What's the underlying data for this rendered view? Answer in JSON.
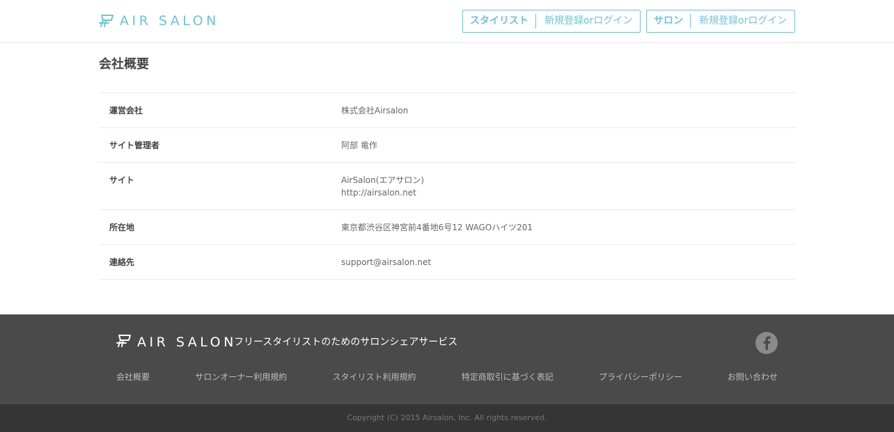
{
  "header": {
    "logo_text": "AIR SALON",
    "stylist": {
      "role": "スタイリスト",
      "action": "新規登録orログイン"
    },
    "salon": {
      "role": "サロン",
      "action": "新規登録orログイン"
    }
  },
  "main": {
    "title": "会社概要",
    "rows": [
      {
        "label": "運営会社",
        "values": [
          "株式会社Airsalon"
        ]
      },
      {
        "label": "サイト管理者",
        "values": [
          "阿部 竜作"
        ]
      },
      {
        "label": "サイト",
        "values": [
          "AirSalon(エアサロン)",
          "http://airsalon.net"
        ]
      },
      {
        "label": "所在地",
        "values": [
          "東京都渋谷区神宮前4番地6号12 WAGOハイツ201"
        ]
      },
      {
        "label": "連絡先",
        "values": [
          "support@airsalon.net"
        ]
      }
    ]
  },
  "footer": {
    "logo_text": "AIR SALON",
    "tagline": "フリースタイリストのためのサロンシェアサービス",
    "social_icon": "facebook-icon",
    "links": [
      "会社概要",
      "サロンオーナー利用規約",
      "スタイリスト利用規約",
      "特定商取引に基づく表記",
      "プライバシーポリシー",
      "お問い合わせ"
    ],
    "copyright": "Copyright (C) 2015 Airsalon, Inc. All rights reserved."
  },
  "colors": {
    "accent": "#6cc3d6",
    "footer_bg": "#4a4a4a",
    "copyright_bg": "#353535"
  }
}
